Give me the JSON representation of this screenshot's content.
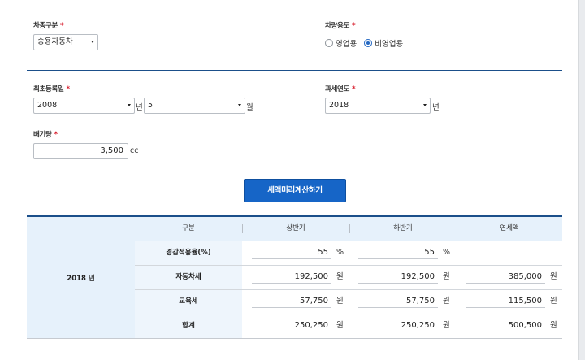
{
  "vehicle": {
    "type_label": "차종구분",
    "type_value": "승용자동차",
    "usage_label": "차량용도",
    "usage_options": [
      "영업용",
      "비영업용"
    ],
    "usage_selected": "비영업용"
  },
  "registration": {
    "label": "최초등록일",
    "year": "2008",
    "year_unit": "년",
    "month": "5",
    "month_unit": "월"
  },
  "tax_year": {
    "label": "과세연도",
    "value": "2018",
    "unit": "년"
  },
  "displacement": {
    "label": "배기량",
    "value": "3,500",
    "unit": "cc"
  },
  "required_mark": "*",
  "calculate_button": "세액미리계산하기",
  "result": {
    "year_label": "2018 년",
    "headers": [
      "구분",
      "상반기",
      "하반기",
      "연세액"
    ],
    "rows": [
      {
        "label": "경감적용율(%)",
        "first": "55",
        "first_unit": "%",
        "second": "55",
        "second_unit": "%",
        "annual": "",
        "annual_unit": ""
      },
      {
        "label": "자동차세",
        "first": "192,500",
        "first_unit": "원",
        "second": "192,500",
        "second_unit": "원",
        "annual": "385,000",
        "annual_unit": "원"
      },
      {
        "label": "교육세",
        "first": "57,750",
        "first_unit": "원",
        "second": "57,750",
        "second_unit": "원",
        "annual": "115,500",
        "annual_unit": "원"
      },
      {
        "label": "합계",
        "first": "250,250",
        "first_unit": "원",
        "second": "250,250",
        "second_unit": "원",
        "annual": "500,500",
        "annual_unit": "원"
      }
    ]
  }
}
